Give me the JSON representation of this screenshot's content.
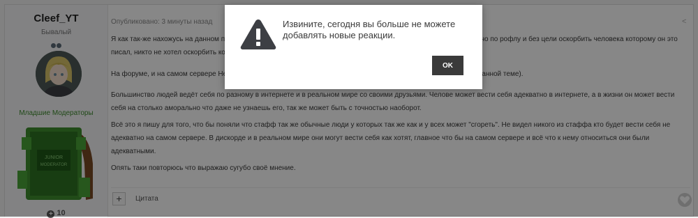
{
  "post": {
    "author": {
      "name": "Cleef_YT",
      "rank": "Бывалый",
      "group": "Младшие Модераторы",
      "reputation": "10",
      "badge_text": "JUNIOR MODERATOR"
    },
    "meta": "Опубликовано: 3 минуты назад",
    "paragraphs": [
      "Я как так-же нахожусь на данном проекте в качестве младшего модератора, то могу сказать что это было написано по рофлу и без цели оскорбить человека которому он это писал, никто не хотел оскорбить кого-либо.",
      "На форуме, и на самом сервере Hello - он ведет себя довольно адекватно (Я лишь высказываю своё мнение по данной теме).",
      "Большинство людей ведёт себя по разному в интернете и в реальном мире со своими друзьями. Челове может вести себя адекватно в интернете, а в жизни он может вести себя на столько аморально что даже не узнаешь его, так же может быть с точностью наоборот.",
      "Всё это я пишу для того, что бы поняли что стафф так же обычные люди у которых так же как и у всех может \"сгореть\". Не видел никого из стаффа кто будет вести себя не адекватно на самом сервере. В дискорде и в реальном мире они могут вести себя как хотят, главное что бы на самом сервере и всё что к нему относиться они были адекватными.",
      "Опять таки повторюсь что выражаю сугубо своё мнение."
    ],
    "footer": {
      "multiquote": "+",
      "quote_label": "Цитата"
    }
  },
  "dialog": {
    "message": "Извините, сегодня вы больше не можете добавлять новые реакции.",
    "ok_label": "OK"
  },
  "icons": {
    "warning": "warning-icon",
    "share": "share-icon",
    "heart": "heart-icon",
    "plus": "plus-circle-icon"
  },
  "colors": {
    "overlay": "#000000",
    "group": "#3d8a2c",
    "ok_button": "#3a3a3a"
  }
}
